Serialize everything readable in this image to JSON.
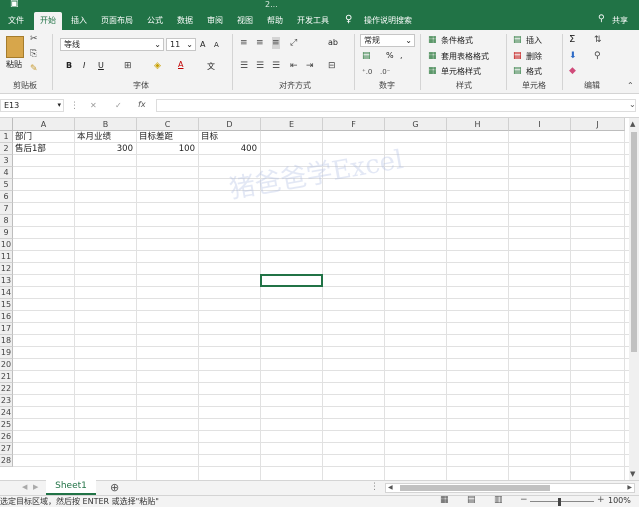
{
  "window": {
    "title": "2..."
  },
  "tabs": [
    {
      "label": "文件"
    },
    {
      "label": "开始"
    },
    {
      "label": "插入"
    },
    {
      "label": "页面布局"
    },
    {
      "label": "公式"
    },
    {
      "label": "数据"
    },
    {
      "label": "审阅"
    },
    {
      "label": "视图"
    },
    {
      "label": "帮助"
    },
    {
      "label": "开发工具"
    }
  ],
  "tellme": "操作说明搜索",
  "share": "共享",
  "ribbon": {
    "clipboard": {
      "paste": "粘贴",
      "label": "剪贴板"
    },
    "font": {
      "name": "等线",
      "size": "11",
      "bold": "B",
      "italic": "I",
      "underline": "U",
      "grow": "A",
      "shrink": "A",
      "color_letter": "A",
      "phonetic": "文",
      "label": "字体"
    },
    "alignment": {
      "label": "对齐方式",
      "wrap": "ab"
    },
    "number": {
      "format": "常规",
      "percent": "%",
      "comma": ",",
      "label": "数字"
    },
    "styles": {
      "conditional": "条件格式",
      "table": "套用表格格式",
      "cell": "单元格样式",
      "label": "样式"
    },
    "cells": {
      "insert": "插入",
      "delete": "删除",
      "format": "格式",
      "label": "单元格"
    },
    "editing": {
      "sum": "Σ",
      "label": "编辑"
    }
  },
  "formula_bar": {
    "name_box": "E13",
    "fx": "fx",
    "cancel": "✕",
    "enter": "✓",
    "value": ""
  },
  "columns": [
    "A",
    "B",
    "C",
    "D",
    "E",
    "F",
    "G",
    "H",
    "I",
    "J"
  ],
  "rows": [
    "1",
    "2",
    "3",
    "4",
    "5",
    "6",
    "7",
    "8",
    "9",
    "10",
    "11",
    "12",
    "13",
    "14",
    "15",
    "16",
    "17",
    "18",
    "19",
    "20",
    "21",
    "22",
    "23",
    "24",
    "25",
    "26",
    "27",
    "28"
  ],
  "cells": [
    {
      "row": 0,
      "col": 0,
      "text": "部门",
      "num": false
    },
    {
      "row": 0,
      "col": 1,
      "text": "本月业绩",
      "num": false
    },
    {
      "row": 0,
      "col": 2,
      "text": "目标差距",
      "num": false
    },
    {
      "row": 0,
      "col": 3,
      "text": "目标",
      "num": false
    },
    {
      "row": 1,
      "col": 0,
      "text": "售后1部",
      "num": false
    },
    {
      "row": 1,
      "col": 1,
      "text": "300",
      "num": true
    },
    {
      "row": 1,
      "col": 2,
      "text": "100",
      "num": true
    },
    {
      "row": 1,
      "col": 3,
      "text": "400",
      "num": true
    }
  ],
  "watermark": "猪爸爸学Excel",
  "sheet_tab": "Sheet1",
  "add_sheet": "⊕",
  "status": {
    "message": "选定目标区域，然后按 ENTER 或选择\"粘贴\"",
    "zoom": "100%"
  },
  "colors": {
    "brand": "#217346"
  }
}
